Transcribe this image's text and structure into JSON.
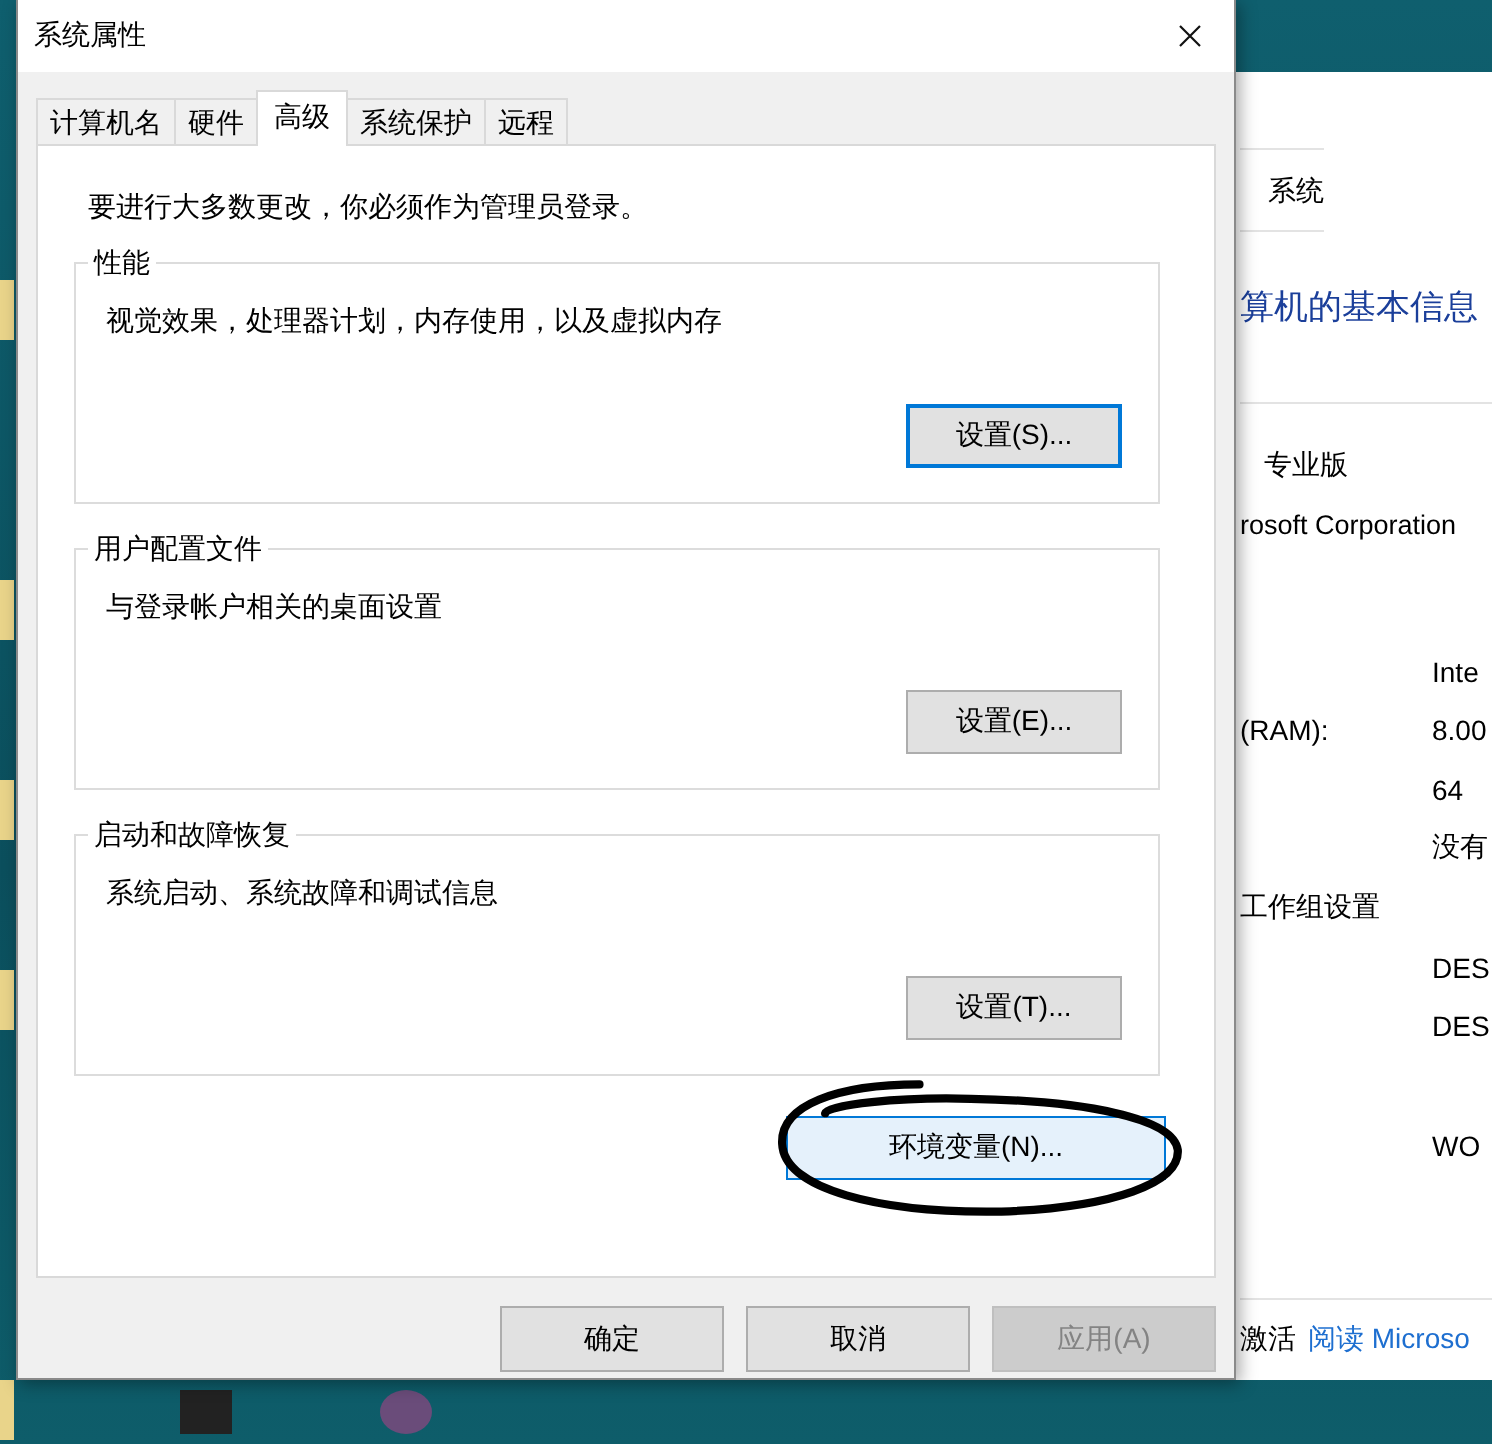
{
  "background_window": {
    "breadcrumb": "系统",
    "heading": "算机的基本信息",
    "rows": [
      {
        "kind": "edition",
        "label": "专业版",
        "value": ""
      },
      {
        "kind": "line",
        "label": "rosoft Corporation",
        "value": ""
      },
      {
        "kind": "spec",
        "label": "",
        "value": "Inte"
      },
      {
        "kind": "spec",
        "label": "(RAM):",
        "value": "8.00"
      },
      {
        "kind": "spec",
        "label": "",
        "value": "64"
      },
      {
        "kind": "spec",
        "label": "",
        "value": "没有"
      },
      {
        "kind": "section",
        "label": "工作组设置",
        "value": ""
      },
      {
        "kind": "spec",
        "label": "",
        "value": "DES"
      },
      {
        "kind": "spec",
        "label": "",
        "value": "DES"
      },
      {
        "kind": "gap",
        "label": "",
        "value": ""
      },
      {
        "kind": "spec",
        "label": "",
        "value": "WO"
      }
    ],
    "footer_text": "激活",
    "footer_link": "阅读 Microso"
  },
  "dialog": {
    "title": "系统属性",
    "tabs": [
      {
        "label": "计算机名",
        "selected": false
      },
      {
        "label": "硬件",
        "selected": false
      },
      {
        "label": "高级",
        "selected": true
      },
      {
        "label": "系统保护",
        "selected": false
      },
      {
        "label": "远程",
        "selected": false
      }
    ],
    "notice": "要进行大多数更改，你必须作为管理员登录。",
    "groups": [
      {
        "title": "性能",
        "description": "视觉效果，处理器计划，内存使用，以及虚拟内存",
        "button": {
          "label": "设置(S)...",
          "default": true
        }
      },
      {
        "title": "用户配置文件",
        "description": "与登录帐户相关的桌面设置",
        "button": {
          "label": "设置(E)...",
          "default": false
        }
      },
      {
        "title": "启动和故障恢复",
        "description": "系统启动、系统故障和调试信息",
        "button": {
          "label": "设置(T)...",
          "default": false
        }
      }
    ],
    "env_button": {
      "label": "环境变量(N)...",
      "hovered": true
    },
    "buttons": [
      {
        "label": "确定",
        "disabled": false
      },
      {
        "label": "取消",
        "disabled": false
      },
      {
        "label": "应用(A)",
        "disabled": true
      }
    ]
  }
}
